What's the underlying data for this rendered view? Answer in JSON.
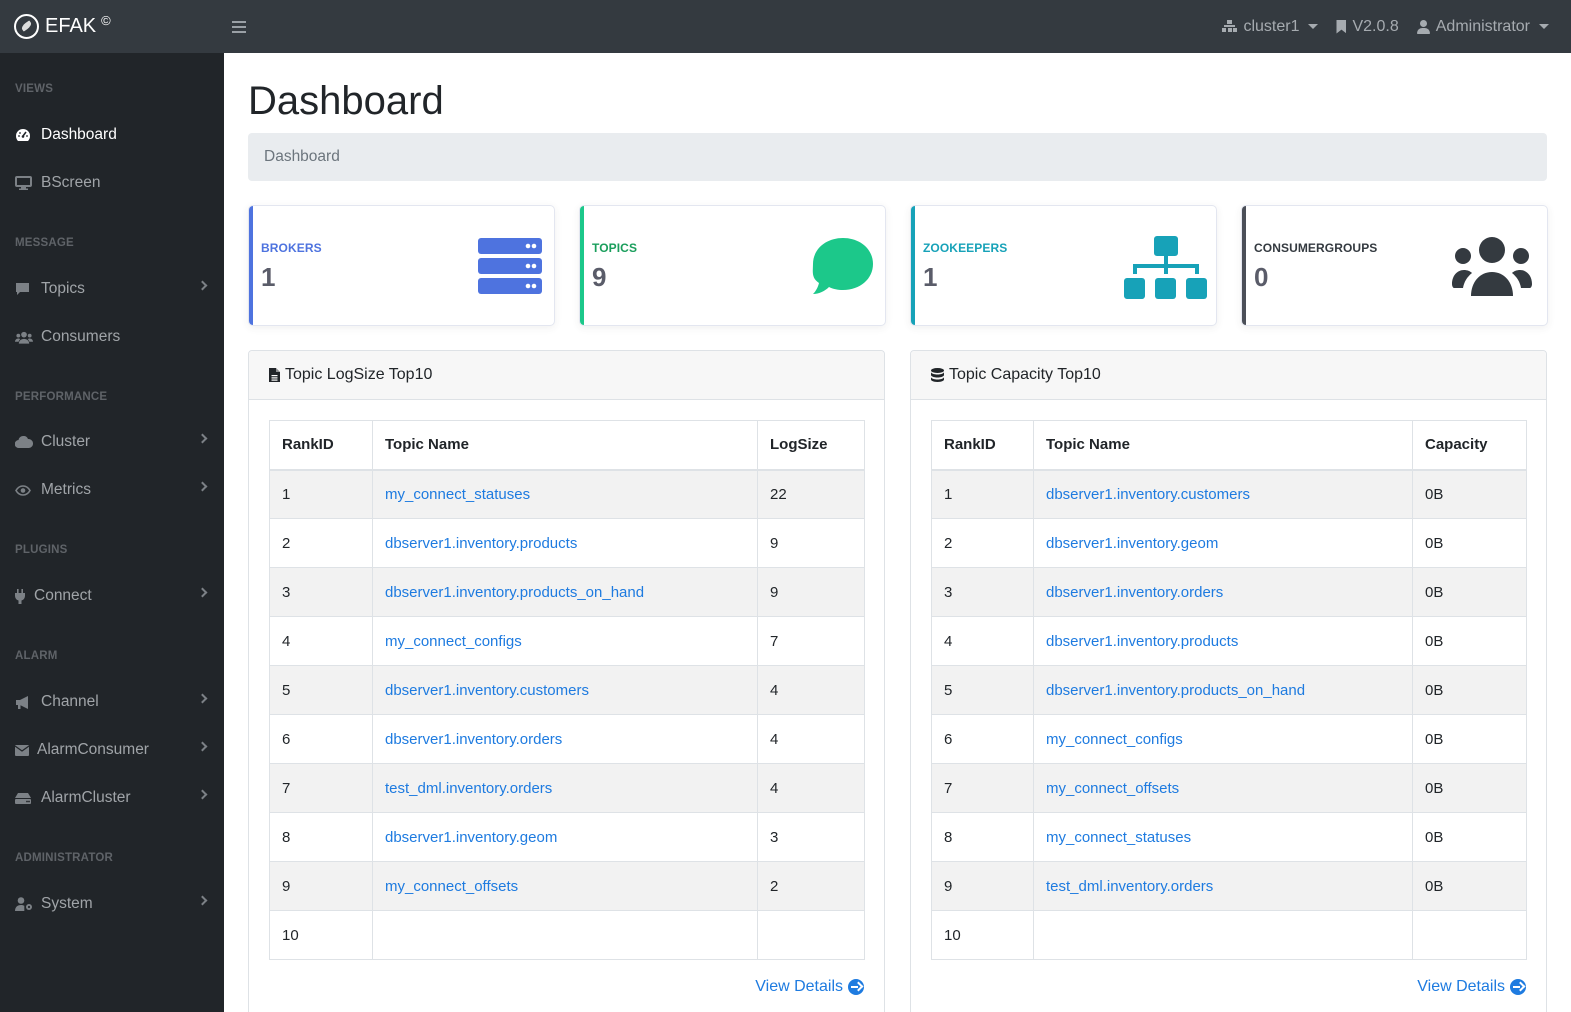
{
  "app": {
    "brand": "EFAK",
    "brand_sup": "©"
  },
  "navbar": {
    "cluster": "cluster1",
    "version": "V2.0.8",
    "user": "Administrator"
  },
  "sidebar": {
    "sections": [
      {
        "heading": "VIEWS",
        "items": [
          {
            "label": "Dashboard",
            "icon": "tachometer-icon",
            "active": true,
            "expandable": false
          },
          {
            "label": "BScreen",
            "icon": "desktop-icon",
            "active": false,
            "expandable": false
          }
        ]
      },
      {
        "heading": "MESSAGE",
        "items": [
          {
            "label": "Topics",
            "icon": "comment-icon",
            "active": false,
            "expandable": true
          },
          {
            "label": "Consumers",
            "icon": "users-icon",
            "active": false,
            "expandable": false
          }
        ]
      },
      {
        "heading": "PERFORMANCE",
        "items": [
          {
            "label": "Cluster",
            "icon": "cloud-icon",
            "active": false,
            "expandable": true
          },
          {
            "label": "Metrics",
            "icon": "eye-icon",
            "active": false,
            "expandable": true
          }
        ]
      },
      {
        "heading": "PLUGINS",
        "items": [
          {
            "label": "Connect",
            "icon": "plug-icon",
            "active": false,
            "expandable": true
          }
        ]
      },
      {
        "heading": "ALARM",
        "items": [
          {
            "label": "Channel",
            "icon": "bullhorn-icon",
            "active": false,
            "expandable": true
          },
          {
            "label": "AlarmConsumer",
            "icon": "envelope-icon",
            "active": false,
            "expandable": true
          },
          {
            "label": "AlarmCluster",
            "icon": "hdd-icon",
            "active": false,
            "expandable": true
          }
        ]
      },
      {
        "heading": "ADMINISTRATOR",
        "items": [
          {
            "label": "System",
            "icon": "user-cog-icon",
            "active": false,
            "expandable": true
          }
        ]
      }
    ]
  },
  "page": {
    "title": "Dashboard",
    "breadcrumb": "Dashboard"
  },
  "stats": [
    {
      "label": "BROKERS",
      "value": "1",
      "color": "#4e73df",
      "icon": "server-icon"
    },
    {
      "label": "TOPICS",
      "value": "9",
      "color": "#1cc88a",
      "label_color": "#1a9e5c",
      "icon": "comment-icon"
    },
    {
      "label": "ZOOKEEPERS",
      "value": "1",
      "color": "#17a2b8",
      "icon": "sitemap-icon"
    },
    {
      "label": "CONSUMERGROUPS",
      "value": "0",
      "color": "#343a40",
      "icon": "users-icon"
    }
  ],
  "logsize_panel": {
    "title": "Topic LogSize Top10",
    "columns": [
      "RankID",
      "Topic Name",
      "LogSize"
    ],
    "rows": [
      [
        "1",
        "my_connect_statuses",
        "22"
      ],
      [
        "2",
        "dbserver1.inventory.products",
        "9"
      ],
      [
        "3",
        "dbserver1.inventory.products_on_hand",
        "9"
      ],
      [
        "4",
        "my_connect_configs",
        "7"
      ],
      [
        "5",
        "dbserver1.inventory.customers",
        "4"
      ],
      [
        "6",
        "dbserver1.inventory.orders",
        "4"
      ],
      [
        "7",
        "test_dml.inventory.orders",
        "4"
      ],
      [
        "8",
        "dbserver1.inventory.geom",
        "3"
      ],
      [
        "9",
        "my_connect_offsets",
        "2"
      ],
      [
        "10",
        "",
        ""
      ]
    ],
    "view_details": "View Details"
  },
  "capacity_panel": {
    "title": "Topic Capacity Top10",
    "columns": [
      "RankID",
      "Topic Name",
      "Capacity"
    ],
    "rows": [
      [
        "1",
        "dbserver1.inventory.customers",
        "0B"
      ],
      [
        "2",
        "dbserver1.inventory.geom",
        "0B"
      ],
      [
        "3",
        "dbserver1.inventory.orders",
        "0B"
      ],
      [
        "4",
        "dbserver1.inventory.products",
        "0B"
      ],
      [
        "5",
        "dbserver1.inventory.products_on_hand",
        "0B"
      ],
      [
        "6",
        "my_connect_configs",
        "0B"
      ],
      [
        "7",
        "my_connect_offsets",
        "0B"
      ],
      [
        "8",
        "my_connect_statuses",
        "0B"
      ],
      [
        "9",
        "test_dml.inventory.orders",
        "0B"
      ],
      [
        "10",
        "",
        ""
      ]
    ],
    "view_details": "View Details"
  }
}
